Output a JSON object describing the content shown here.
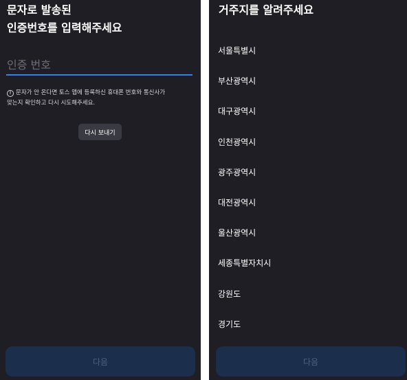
{
  "verification": {
    "title_line1": "문자로 발송된",
    "title_line2": "인증번호를 입력해주세요",
    "input_value": "",
    "input_placeholder": "인증 번호",
    "info_icon": "info-circle-icon",
    "notice_line1": "문자가 안 온다면 토스 앱에 등록하신 휴대폰 번호와 통신사가",
    "notice_line2": "맞는지 확인하고 다시 시도해주세요.",
    "resend_label": "다시 보내기",
    "next_label": "다음"
  },
  "residence": {
    "title": "거주지를 알려주세요",
    "regions": [
      {
        "label": "서울특별시"
      },
      {
        "label": "부산광역시"
      },
      {
        "label": "대구광역시"
      },
      {
        "label": "인천광역시"
      },
      {
        "label": "광주광역시"
      },
      {
        "label": "대전광역시"
      },
      {
        "label": "울산광역시"
      },
      {
        "label": "세종특별자치시"
      },
      {
        "label": "강원도"
      },
      {
        "label": "경기도"
      }
    ],
    "next_label": "다음"
  },
  "colors": {
    "background": "#1e1e24",
    "accent": "#3182f6",
    "button_disabled_bg": "#1b2e4c",
    "button_disabled_text": "#4d6180",
    "secondary_button_bg": "#3a3a42"
  }
}
